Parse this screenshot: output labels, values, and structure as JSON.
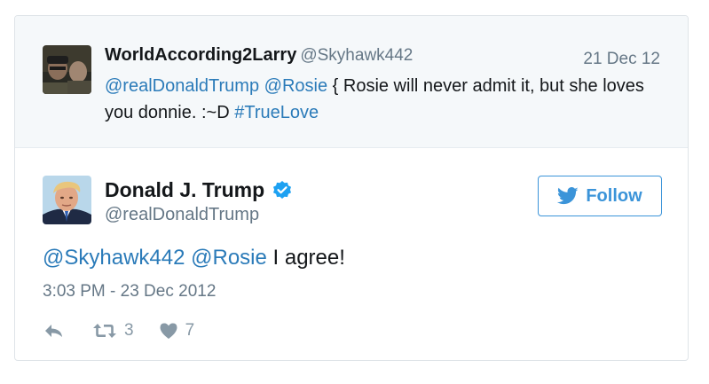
{
  "quoted_tweet": {
    "author_name": "WorldAccording2Larry",
    "author_handle": "@Skyhawk442",
    "date": "21 Dec 12",
    "mention_1": "@realDonaldTrump",
    "mention_2": "@Rosie",
    "body_text": " { Rosie will never admit it, but she loves you donnie. :~D ",
    "hashtag": "#TrueLove"
  },
  "tweet": {
    "author_name": "Donald J. Trump",
    "author_handle": "@realDonaldTrump",
    "verified": true,
    "follow_label": "Follow",
    "mention_1": "@Skyhawk442",
    "mention_2": "@Rosie",
    "body_text": " I agree!",
    "timestamp": "3:03 PM - 23 Dec 2012",
    "retweet_count": "3",
    "like_count": "7"
  },
  "colors": {
    "link": "#2b7bb9",
    "follow_accent": "#3b94d9",
    "verified_badge": "#1da1f2",
    "muted_text": "#657786",
    "action_icon": "#8899a6",
    "quoted_background": "#f5f8fa"
  },
  "icons": {
    "reply": "reply-icon",
    "retweet": "retweet-icon",
    "like": "heart-icon",
    "follow": "twitter-bird-icon",
    "verified": "verified-badge-icon"
  }
}
